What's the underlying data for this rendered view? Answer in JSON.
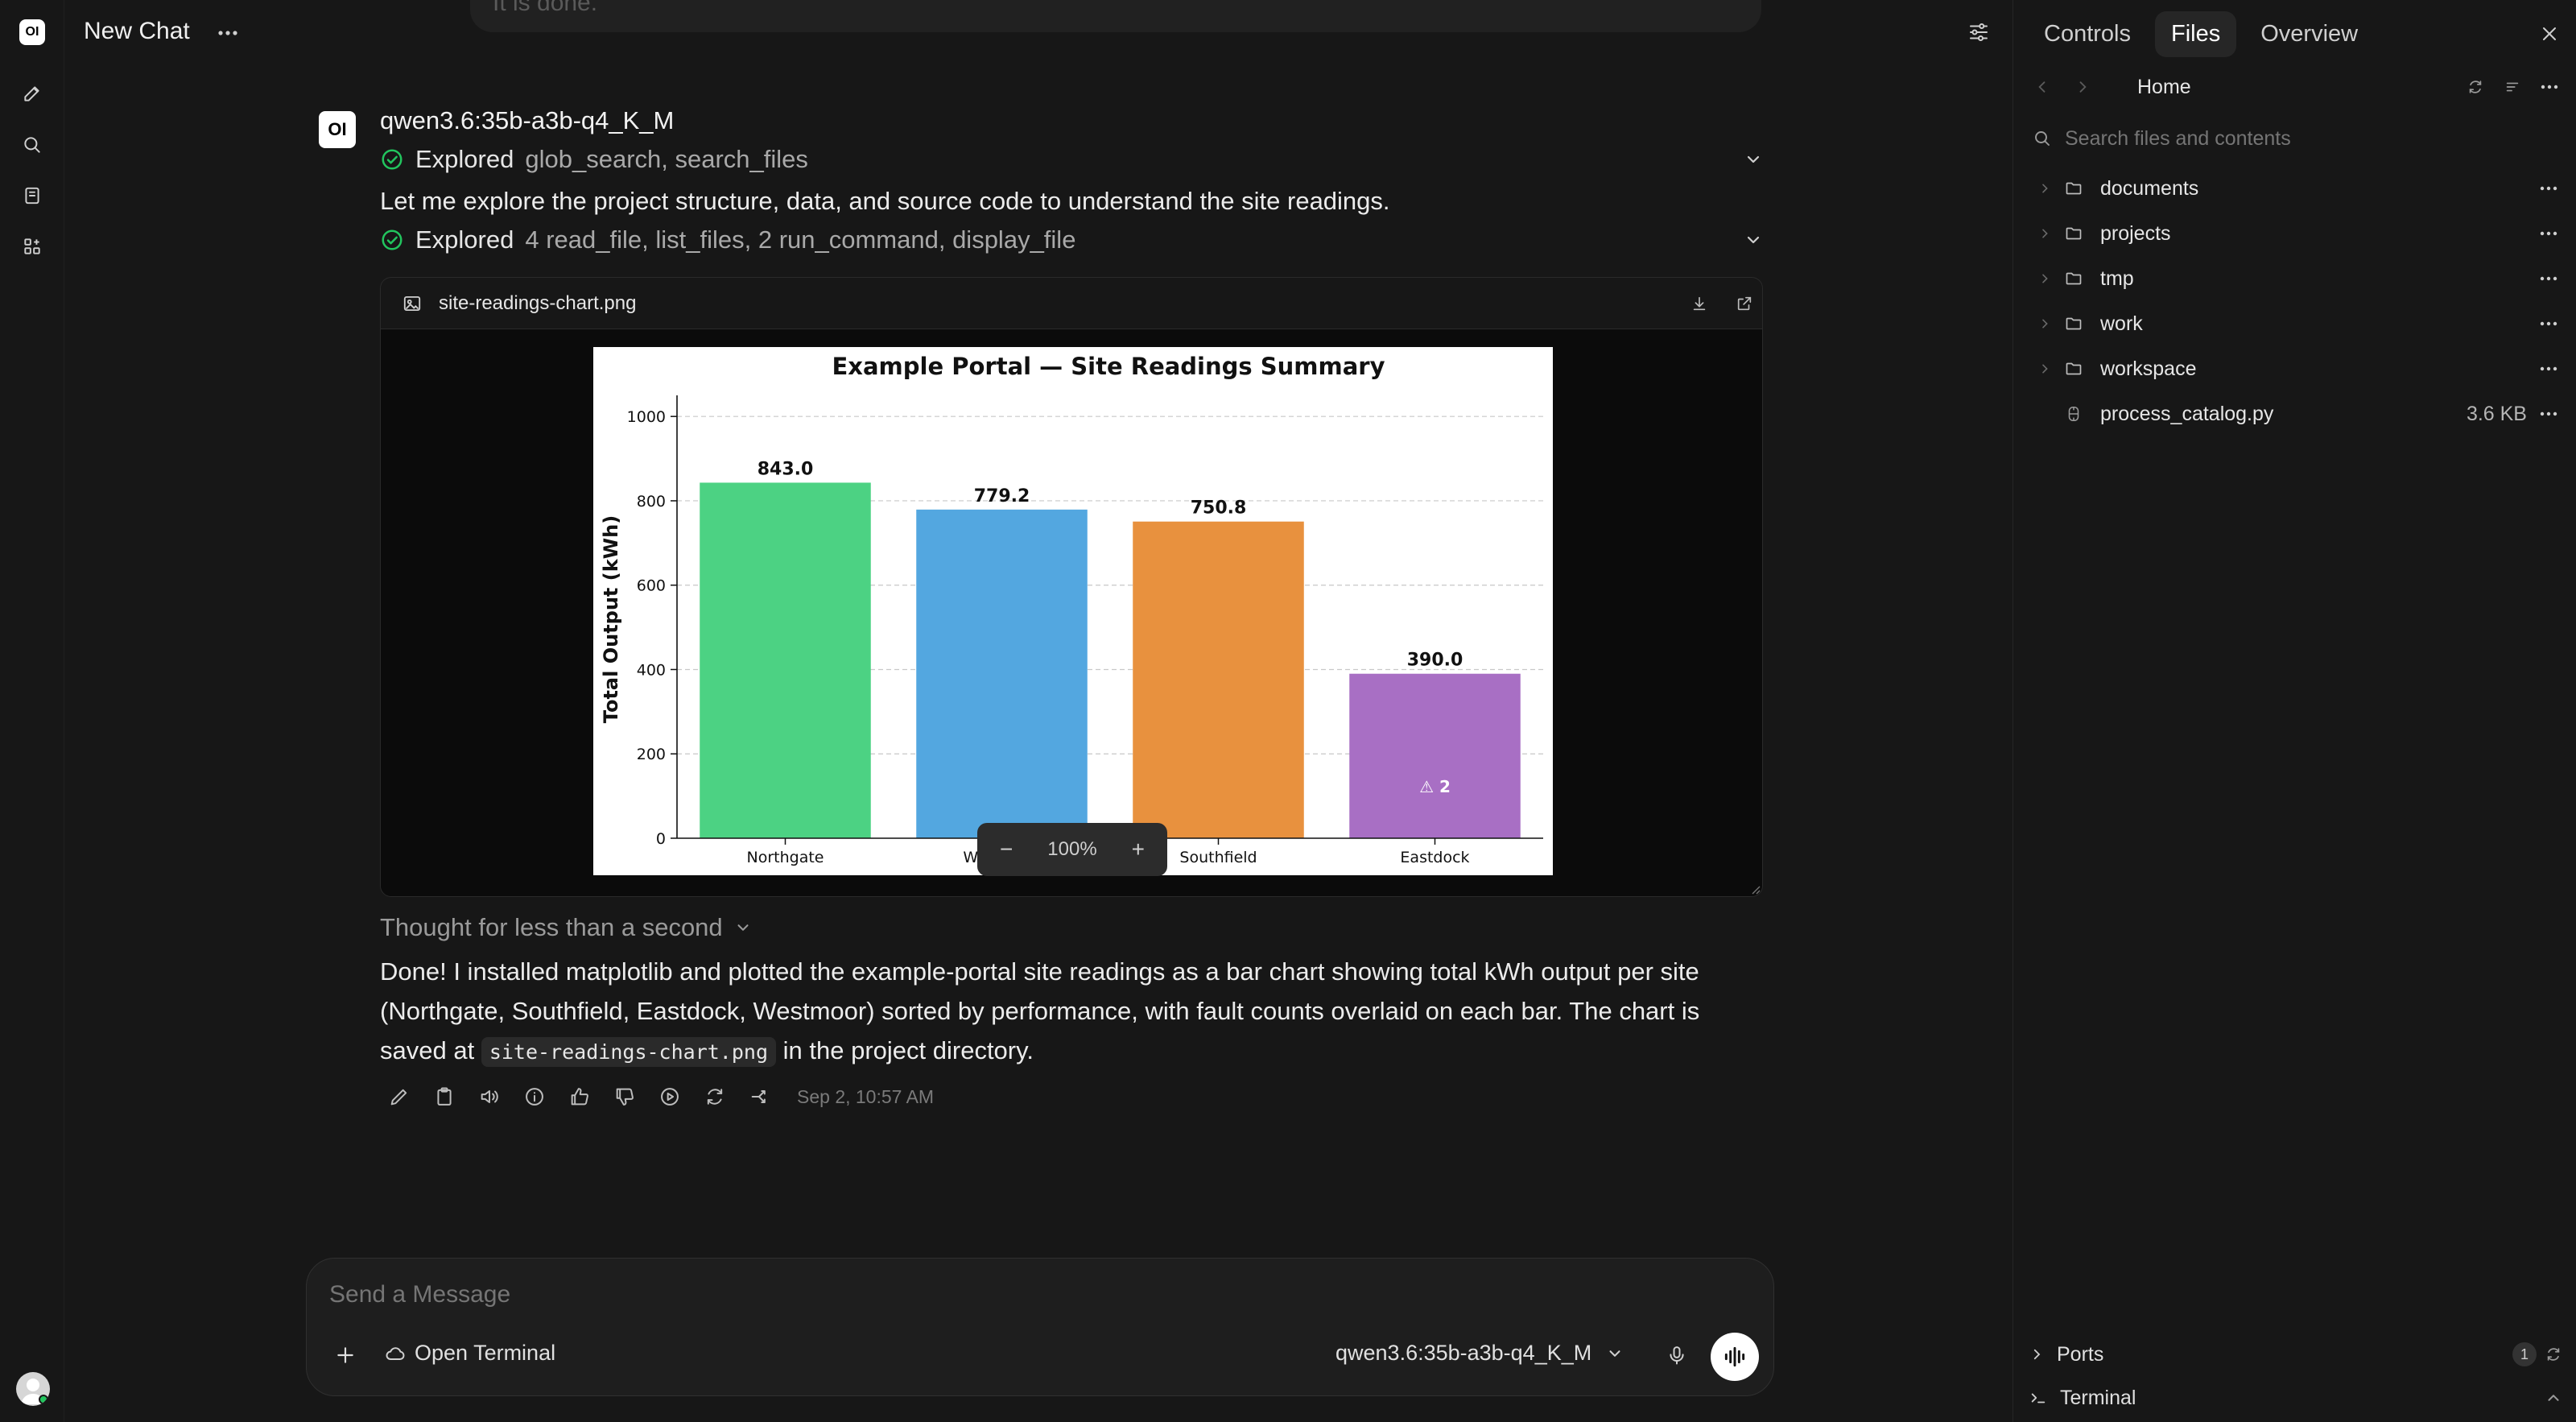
{
  "app": {
    "logo_text": "OI"
  },
  "header": {
    "title": "New Chat"
  },
  "previous_message": {
    "text": "It is done."
  },
  "assistant": {
    "avatar_text": "OI",
    "model_name": "qwen3.6:35b-a3b-q4_K_M",
    "explored_1": {
      "label": "Explored",
      "tools": "glob_search, search_files"
    },
    "intro": "Let me explore the project structure, data, and source code to understand the site readings.",
    "explored_2": {
      "label": "Explored",
      "tools": "4 read_file, list_files, 2 run_command, display_file"
    },
    "file": {
      "name": "site-readings-chart.png"
    },
    "zoom": {
      "minus": "−",
      "level": "100%",
      "plus": "+"
    },
    "thought": "Thought for less than a second",
    "answer_part1": "Done! I installed matplotlib and plotted the example-portal site readings as a bar chart showing total kWh output per site (Northgate, Southfield, Eastdock, Westmoor) sorted by performance, with fault counts overlaid on each bar. The chart is saved at",
    "answer_code": "site-readings-chart.png",
    "answer_part2": "in the project directory.",
    "timestamp": "Sep 2, 10:57 AM"
  },
  "chart_data": {
    "type": "bar",
    "title": "Example Portal — Site Readings Summary",
    "xlabel": "",
    "ylabel": "Total Output (kWh)",
    "categories": [
      "Northgate",
      "Westmoor",
      "Southfield",
      "Eastdock"
    ],
    "values": [
      843.0,
      779.2,
      750.8,
      390.0
    ],
    "value_labels": [
      "843.0",
      "779.2",
      "750.8",
      "390.0"
    ],
    "colors": [
      "#4cd283",
      "#53a7e0",
      "#e8913e",
      "#a86fc4"
    ],
    "annotation": {
      "category": "Eastdock",
      "text": "⚠ 2"
    },
    "ylim": [
      0,
      1050
    ],
    "yticks": [
      0,
      200,
      400,
      600,
      800,
      1000
    ],
    "grid": true
  },
  "composer": {
    "placeholder": "Send a Message",
    "open_terminal": "Open Terminal",
    "model": "qwen3.6:35b-a3b-q4_K_M"
  },
  "right_panel": {
    "tabs": [
      "Controls",
      "Files",
      "Overview"
    ],
    "active_tab": "Files",
    "breadcrumb": "Home",
    "search_placeholder": "Search files and contents",
    "items": [
      {
        "name": "documents",
        "type": "folder"
      },
      {
        "name": "projects",
        "type": "folder"
      },
      {
        "name": "tmp",
        "type": "folder"
      },
      {
        "name": "work",
        "type": "folder"
      },
      {
        "name": "workspace",
        "type": "folder"
      },
      {
        "name": "process_catalog.py",
        "type": "file",
        "size": "3.6 KB"
      }
    ],
    "ports": {
      "label": "Ports",
      "count": "1"
    },
    "terminal": {
      "label": "Terminal"
    }
  },
  "colors": {
    "background": "#171717",
    "accent_check": "#22c55e"
  }
}
